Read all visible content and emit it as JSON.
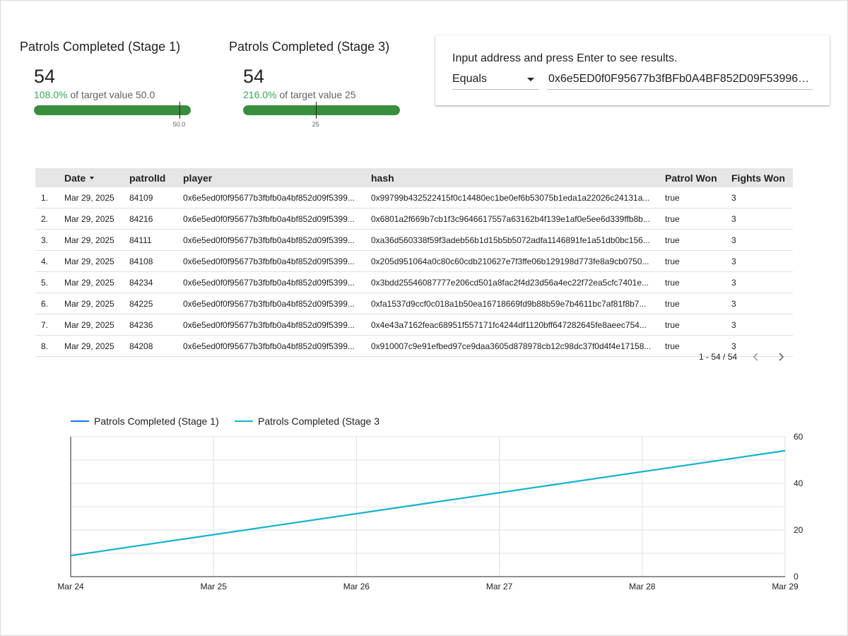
{
  "scorecards": [
    {
      "title": "Patrols Completed (Stage 1)",
      "value": "54",
      "percent": "108.0%",
      "target_text": "of target value 50.0",
      "marker_label": "50.0",
      "progress_fraction": 1.0,
      "target_fraction": 0.926
    },
    {
      "title": "Patrols Completed (Stage 3)",
      "value": "54",
      "percent": "216.0%",
      "target_text": "of target value 25",
      "marker_label": "25",
      "progress_fraction": 1.0,
      "target_fraction": 0.463
    }
  ],
  "filter": {
    "label": "Input address and press Enter to see results.",
    "operator": "Equals",
    "value": "0x6e5ED0f0F95677b3fBFb0A4BF852D09F539961..."
  },
  "table": {
    "columns": [
      "Date",
      "patrolId",
      "player",
      "hash",
      "Patrol Won",
      "Fights Won"
    ],
    "rows": [
      {
        "idx": "1.",
        "date": "Mar 29, 2025",
        "patrolId": "84109",
        "player": "0x6e5ed0f0f95677b3fbfb0a4bf852d09f5399...",
        "hash": "0x99799b432522415f0c14480ec1be0ef6b53075b1eda1a22026c24131a...",
        "won": "true",
        "fights": "3"
      },
      {
        "idx": "2.",
        "date": "Mar 29, 2025",
        "patrolId": "84216",
        "player": "0x6e5ed0f0f95677b3fbfb0a4bf852d09f5399...",
        "hash": "0x6801a2f669b7cb1f3c9646617557a63162b4f139e1af0e5ee6d339ffb8b...",
        "won": "true",
        "fights": "3"
      },
      {
        "idx": "3.",
        "date": "Mar 29, 2025",
        "patrolId": "84111",
        "player": "0x6e5ed0f0f95677b3fbfb0a4bf852d09f5399...",
        "hash": "0xa36d560338f59f3adeb56b1d15b5b5072adfa1146891fe1a51db0bc156...",
        "won": "true",
        "fights": "3"
      },
      {
        "idx": "4.",
        "date": "Mar 29, 2025",
        "patrolId": "84108",
        "player": "0x6e5ed0f0f95677b3fbfb0a4bf852d09f5399...",
        "hash": "0x205d951064a0c80c60cdb210627e7f3ffe06b129198d773fe8a9cb0750...",
        "won": "true",
        "fights": "3"
      },
      {
        "idx": "5.",
        "date": "Mar 29, 2025",
        "patrolId": "84234",
        "player": "0x6e5ed0f0f95677b3fbfb0a4bf852d09f5399...",
        "hash": "0x3bdd25546087777e206cd501a8fac2f4d23d56a4ec22f72ea5cfc7401e...",
        "won": "true",
        "fights": "3"
      },
      {
        "idx": "6.",
        "date": "Mar 29, 2025",
        "patrolId": "84225",
        "player": "0x6e5ed0f0f95677b3fbfb0a4bf852d09f5399...",
        "hash": "0xfa1537d9ccf0c018a1b50ea16718669fd9b88b59e7b4611bc7af81f8b7...",
        "won": "true",
        "fights": "3"
      },
      {
        "idx": "7.",
        "date": "Mar 29, 2025",
        "patrolId": "84236",
        "player": "0x6e5ed0f0f95677b3fbfb0a4bf852d09f5399...",
        "hash": "0x4e43a7162feac68951f557171fc4244df1120bff647282645fe8aeec754...",
        "won": "true",
        "fights": "3"
      },
      {
        "idx": "8.",
        "date": "Mar 29, 2025",
        "patrolId": "84208",
        "player": "0x6e5ed0f0f95677b3fbfb0a4bf852d09f5399...",
        "hash": "0x910007c9e91efbed97ce9daa3605d878978cb12c98dc37f0d4f4e17158...",
        "won": "true",
        "fights": "3"
      }
    ],
    "pagination": "1 - 54 / 54"
  },
  "chart_data": {
    "type": "line",
    "x": [
      "Mar 24",
      "Mar 25",
      "Mar 26",
      "Mar 27",
      "Mar 28",
      "Mar 29"
    ],
    "series": [
      {
        "name": "Patrols Completed (Stage 1)",
        "color": "#1a73e8",
        "values": [
          9,
          18,
          27,
          36,
          45,
          54
        ]
      },
      {
        "name": "Patrols Completed (Stage 3",
        "color": "#12b5cb",
        "values": [
          9,
          18,
          27,
          36,
          45,
          54
        ]
      }
    ],
    "ylim": [
      0,
      60
    ],
    "yticks": [
      "0",
      "20",
      "40",
      "60"
    ],
    "y_axis_side": "right",
    "grid": true,
    "legend_position": "top-left"
  },
  "icons": {
    "pager_prev": "chevron-left-icon",
    "pager_next": "chevron-right-icon",
    "select_caret": "caret-down-icon"
  }
}
